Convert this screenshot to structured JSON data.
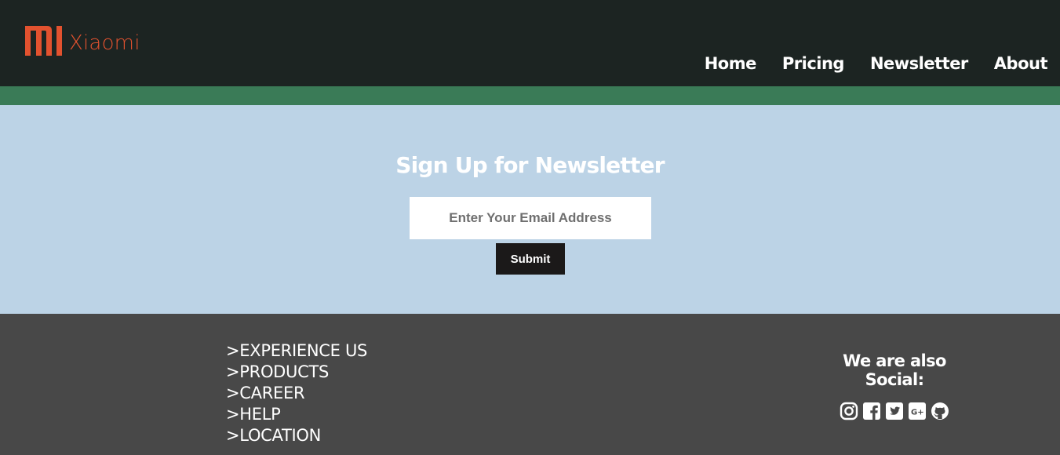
{
  "header": {
    "brand": "Xiaomi",
    "brand_color": "#e2522f",
    "background": "#1c2422",
    "nav": [
      {
        "label": "Home"
      },
      {
        "label": "Pricing"
      },
      {
        "label": "Newsletter"
      },
      {
        "label": "About"
      }
    ]
  },
  "accent_bar_color": "#3a7b57",
  "newsletter": {
    "title": "Sign Up for Newsletter",
    "email_placeholder": "Enter Your Email Address",
    "email_value": "",
    "submit_label": "Submit",
    "background": "#bcd3e6"
  },
  "footer": {
    "background": "#484848",
    "links": [
      {
        "label": ">EXPERIENCE US"
      },
      {
        "label": ">PRODUCTS"
      },
      {
        "label": ">CAREER"
      },
      {
        "label": ">HELP"
      },
      {
        "label": ">LOCATION"
      }
    ],
    "social_title": "We are also Social:",
    "social_icons": [
      "instagram-icon",
      "facebook-icon",
      "twitter-icon",
      "google-plus-icon",
      "github-icon"
    ]
  }
}
